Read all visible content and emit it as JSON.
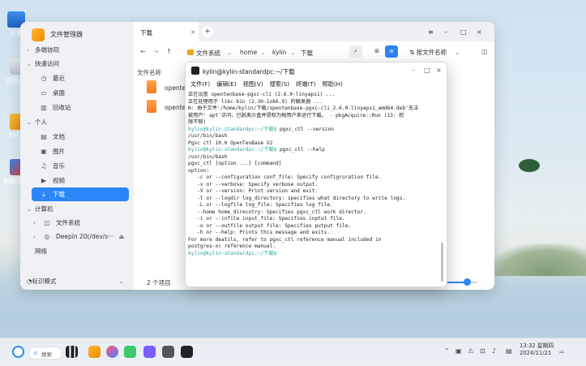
{
  "desktop": {
    "icons": [
      {
        "label": "计算"
      },
      {
        "label": "回收站"
      },
      {
        "label": "Kylin"
      },
      {
        "label": "麒麟安全"
      }
    ]
  },
  "file_manager": {
    "app_title": "文件管理器",
    "sidebar": {
      "sections": [
        {
          "label": "多端协同",
          "icon": "devices-icon"
        },
        {
          "label": "快速访问",
          "icon": "clock-icon"
        }
      ],
      "quick": [
        {
          "label": "最近",
          "icon": "clock-icon"
        },
        {
          "label": "桌面",
          "icon": "desktop-icon"
        },
        {
          "label": "回收站",
          "icon": "trash-icon"
        }
      ],
      "personal_label": "个人",
      "personal": [
        {
          "label": "文档"
        },
        {
          "label": "图片"
        },
        {
          "label": "音乐"
        },
        {
          "label": "视频"
        },
        {
          "label": "下载"
        }
      ],
      "computer_label": "计算机",
      "computer": [
        {
          "label": "文件系统"
        },
        {
          "label": "Deepin 20(/dev/s···"
        }
      ],
      "network_label": "网络",
      "mode_label": "标识模式"
    },
    "tab": {
      "label": "下载",
      "close": "×",
      "add": "+"
    },
    "window_controls": {
      "menu": "≡",
      "minimize": "–",
      "maximize": "□",
      "close": "×"
    },
    "toolbar": {
      "back": "←",
      "forward": "→",
      "up": "↑",
      "path": [
        "文件系统",
        "home",
        "kylin",
        "下载"
      ],
      "sort_label": "按文件名称"
    },
    "column_header": "文件名称",
    "files": [
      {
        "name": "opente"
      },
      {
        "name": "opente"
      }
    ],
    "count": "2 个项目"
  },
  "terminal": {
    "title": "kylin@kylin-standardpc:~/下载",
    "menu": [
      "文件(F)",
      "编辑(E)",
      "视图(V)",
      "搜索(S)",
      "终端(T)",
      "帮助(H)"
    ],
    "lines": [
      {
        "t": "正在设置 opentenbase-pgxc-cli (2.6.0-linyaps1) ..."
      },
      {
        "t": "正在处理用于 libc-bin (2.30-1ok6.9) 的触发器 ..."
      },
      {
        "t": "N: 由于文件'/home/kylin/下载/opentenbase-pgxc-cli_2.6.0-linyaps1_amd64.deb'无法"
      },
      {
        "t": "被用户' apt'访问，已脱离沙盒并提权为根用户来运行下载。 - pkgAcquire::Run (13: 权"
      },
      {
        "t": "限不够)"
      },
      {
        "p": "kylin@kylin-standardpc:~/下载$",
        "t": " pgxc_ctl --version"
      },
      {
        "t": "/usr/bin/bash"
      },
      {
        "t": "Pgxc ctl 10.0 OpenTenBase V2"
      },
      {
        "p": "kylin@kylin-standardpc:~/下载$",
        "t": " pgxc_ctl --help"
      },
      {
        "t": "/usr/bin/bash"
      },
      {
        "t": "pgxc_ctl [option ...] [command]"
      },
      {
        "t": "option:"
      },
      {
        "t": "   -c or --configuration conf_file: Specify configruration file."
      },
      {
        "t": "   -v or --verbose: Specify verbose output."
      },
      {
        "t": "   -V or --version: Print version and exit."
      },
      {
        "t": "   -l or --logdir log_directory: specifies what directory to write logs."
      },
      {
        "t": "   -L or --logfile log_file: Specifies log file."
      },
      {
        "t": "   --home home_direcotry: Specifies pgxc_ctl work director."
      },
      {
        "t": "   -i or --infile input_file: Specifies inptut file."
      },
      {
        "t": "   -o or --outfile output file: Specifies putput file."
      },
      {
        "t": "   -h or --help: Prints this message and exits."
      },
      {
        "t": "For more deatils, refer to pgxc_ctl reference manual included in"
      },
      {
        "t": "postgres-xc reference manual."
      },
      {
        "p": "kylin@kylin-standardpc:~/下载$",
        "t": ""
      }
    ]
  },
  "taskbar": {
    "search_label": "搜索",
    "time": "13:32 星期四",
    "date": "2024/11/21"
  },
  "colors": {
    "accent": "#2b86f7",
    "prompt": "#2aa198",
    "folder_orange": "#f38b00"
  }
}
